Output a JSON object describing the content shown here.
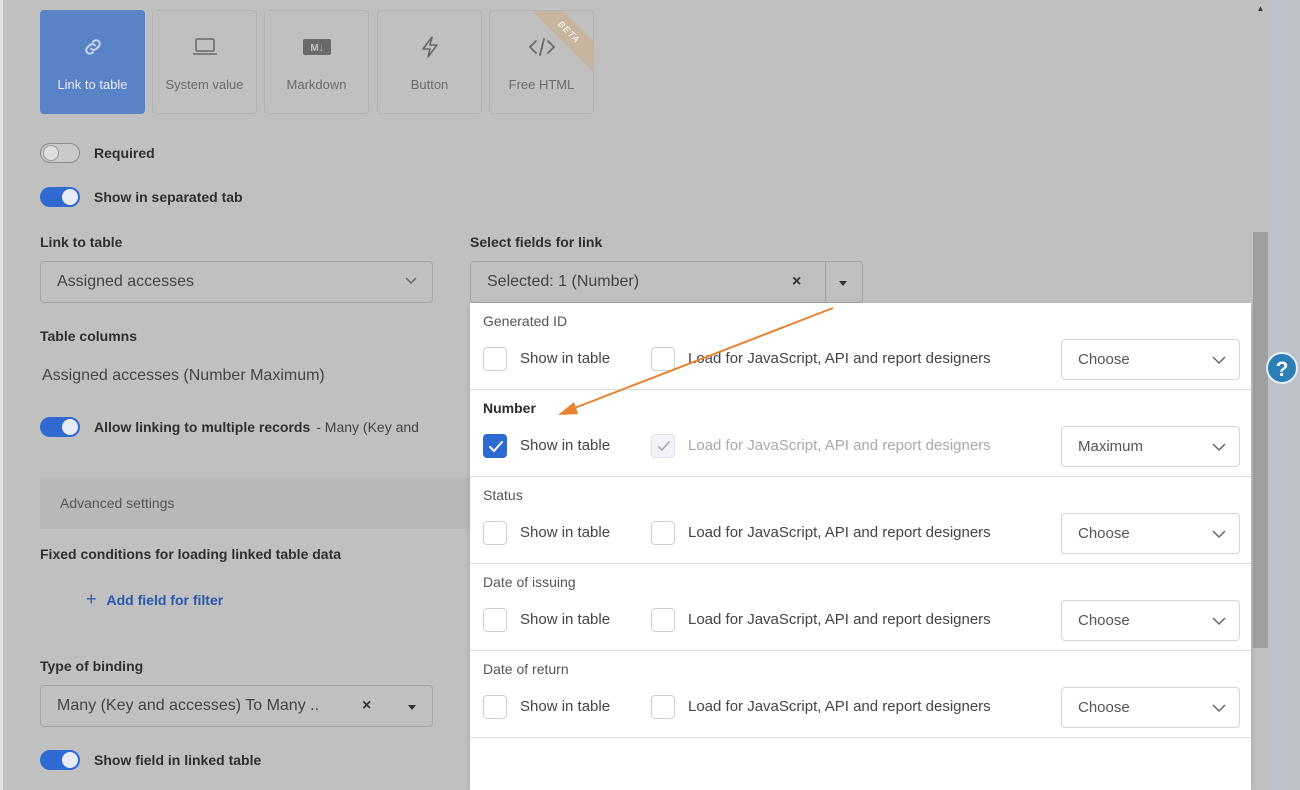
{
  "field_types": [
    {
      "label": "Link to table",
      "icon": "link-icon",
      "active": true
    },
    {
      "label": "System value",
      "icon": "laptop-icon",
      "active": false
    },
    {
      "label": "Markdown",
      "icon": "markdown-icon",
      "active": false
    },
    {
      "label": "Button",
      "icon": "lightning-icon",
      "active": false
    },
    {
      "label": "Free HTML",
      "icon": "code-icon",
      "active": false,
      "badge": "BETA"
    }
  ],
  "toggles": {
    "required": {
      "label": "Required",
      "on": false
    },
    "separated_tab": {
      "label": "Show in separated tab",
      "on": true
    },
    "multiple_records": {
      "label": "Allow linking to multiple records",
      "extra": "- Many (Key and",
      "on": true
    },
    "show_in_linked": {
      "label": "Show field in linked table",
      "on": true
    }
  },
  "link_to_table": {
    "label": "Link to table",
    "value": "Assigned accesses"
  },
  "select_fields": {
    "label": "Select fields for link",
    "value": "Selected: 1 (Number)",
    "clear": "×"
  },
  "table_columns": {
    "label": "Table columns",
    "value": "Assigned accesses (Number Maximum)"
  },
  "advanced": {
    "label": "Advanced settings"
  },
  "fixed_conditions": {
    "label": "Fixed conditions for loading linked table data",
    "add_label": "Add field for filter",
    "plus": "+"
  },
  "binding": {
    "label": "Type of binding",
    "value": "Many (Key and accesses) To Many ..",
    "clear": "×"
  },
  "fields_panel": {
    "show_label": "Show in table",
    "load_label": "Load for JavaScript, API and report designers",
    "groups": [
      {
        "name": "Generated ID",
        "show": false,
        "load": false,
        "load_state": "unchecked",
        "aggregate": "Choose"
      },
      {
        "name": "Number",
        "show": true,
        "load": true,
        "load_state": "disabled-checked",
        "aggregate": "Maximum"
      },
      {
        "name": "Status",
        "show": false,
        "load": false,
        "load_state": "unchecked",
        "aggregate": "Choose"
      },
      {
        "name": "Date of issuing",
        "show": false,
        "load": false,
        "load_state": "unchecked",
        "aggregate": "Choose"
      },
      {
        "name": "Date of return",
        "show": false,
        "load": false,
        "load_state": "unchecked",
        "aggregate": "Choose"
      }
    ]
  },
  "help": {
    "label": "?"
  },
  "colors": {
    "accent": "#2f6ad2",
    "annotation_arrow": "#e8822f",
    "overlay": "#c0c0c0",
    "link": "#2a55b0"
  }
}
